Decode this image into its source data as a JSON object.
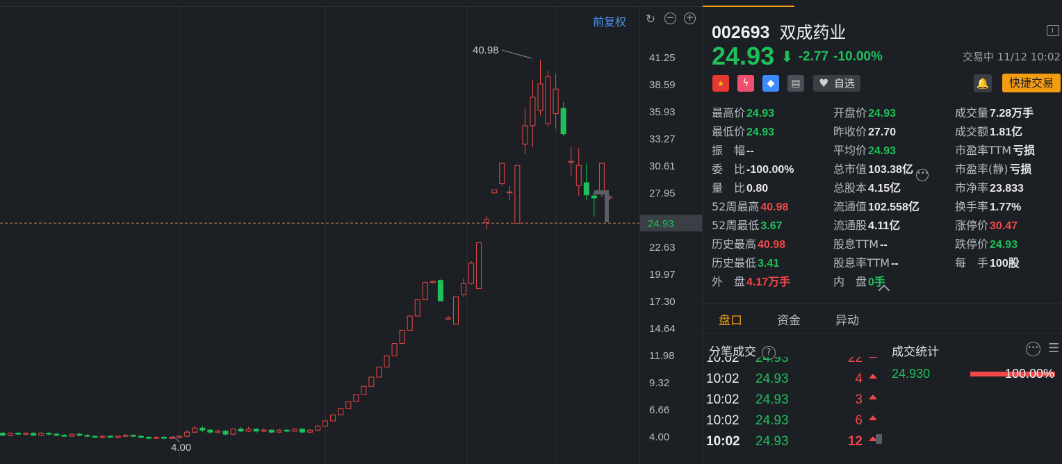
{
  "chart": {
    "adjust_mode": "前复权",
    "high_label": "40.98",
    "low_label": "4.00",
    "y_ticks": [
      "41.25",
      "38.59",
      "35.93",
      "33.27",
      "30.61",
      "27.95",
      "24.93",
      "22.63",
      "19.97",
      "17.30",
      "14.64",
      "11.98",
      "9.32",
      "6.66",
      "4.00"
    ],
    "current_price_tag": "24.93",
    "colors": {
      "up": "#f04848",
      "down": "#1fc05a",
      "price_tag": "#3a3e45",
      "dash": "#c88a4a"
    }
  },
  "chart_data": {
    "type": "candlestick",
    "ylim": [
      4.0,
      41.25
    ],
    "current_price": 24.93,
    "candles": [
      {
        "o": 4.3,
        "c": 4.1,
        "h": 4.4,
        "l": 4.0
      },
      {
        "o": 4.1,
        "c": 4.3,
        "h": 4.4,
        "l": 4.0
      },
      {
        "o": 4.3,
        "c": 4.2,
        "h": 4.4,
        "l": 4.1
      },
      {
        "o": 4.2,
        "c": 4.3,
        "h": 4.4,
        "l": 4.1
      },
      {
        "o": 4.3,
        "c": 4.1,
        "h": 4.4,
        "l": 4.0
      },
      {
        "o": 4.1,
        "c": 4.3,
        "h": 4.4,
        "l": 4.0
      },
      {
        "o": 4.3,
        "c": 4.2,
        "h": 4.4,
        "l": 4.1
      },
      {
        "o": 4.2,
        "c": 4.1,
        "h": 4.3,
        "l": 4.0
      },
      {
        "o": 4.1,
        "c": 4.0,
        "h": 4.2,
        "l": 3.9
      },
      {
        "o": 4.0,
        "c": 4.2,
        "h": 4.3,
        "l": 3.9
      },
      {
        "o": 4.2,
        "c": 4.1,
        "h": 4.3,
        "l": 4.0
      },
      {
        "o": 4.1,
        "c": 4.0,
        "h": 4.2,
        "l": 3.9
      },
      {
        "o": 4.0,
        "c": 3.9,
        "h": 4.1,
        "l": 3.8
      },
      {
        "o": 3.9,
        "c": 4.0,
        "h": 4.1,
        "l": 3.8
      },
      {
        "o": 4.0,
        "c": 3.9,
        "h": 4.1,
        "l": 3.8
      },
      {
        "o": 3.9,
        "c": 4.0,
        "h": 4.1,
        "l": 3.8
      },
      {
        "o": 4.0,
        "c": 4.1,
        "h": 4.2,
        "l": 3.9
      },
      {
        "o": 4.1,
        "c": 4.0,
        "h": 4.2,
        "l": 3.9
      },
      {
        "o": 4.0,
        "c": 3.9,
        "h": 4.1,
        "l": 3.8
      },
      {
        "o": 3.9,
        "c": 3.8,
        "h": 4.0,
        "l": 3.7
      },
      {
        "o": 3.8,
        "c": 3.9,
        "h": 4.0,
        "l": 3.7
      },
      {
        "o": 3.9,
        "c": 3.8,
        "h": 4.0,
        "l": 3.7
      },
      {
        "o": 3.8,
        "c": 3.9,
        "h": 4.0,
        "l": 3.7
      },
      {
        "o": 3.9,
        "c": 4.0,
        "h": 4.1,
        "l": 3.8
      },
      {
        "o": 4.0,
        "c": 4.4,
        "h": 4.6,
        "l": 3.9
      },
      {
        "o": 4.4,
        "c": 4.8,
        "h": 5.0,
        "l": 4.3
      },
      {
        "o": 4.8,
        "c": 4.6,
        "h": 5.0,
        "l": 4.4
      },
      {
        "o": 4.6,
        "c": 4.4,
        "h": 4.7,
        "l": 4.2
      },
      {
        "o": 4.4,
        "c": 4.5,
        "h": 4.7,
        "l": 4.2
      },
      {
        "o": 4.5,
        "c": 4.2,
        "h": 4.6,
        "l": 4.1
      },
      {
        "o": 4.2,
        "c": 4.7,
        "h": 4.8,
        "l": 4.1
      },
      {
        "o": 4.7,
        "c": 4.5,
        "h": 4.9,
        "l": 4.4
      },
      {
        "o": 4.5,
        "c": 4.7,
        "h": 4.9,
        "l": 4.4
      },
      {
        "o": 4.7,
        "c": 4.5,
        "h": 4.8,
        "l": 4.3
      },
      {
        "o": 4.5,
        "c": 4.6,
        "h": 4.8,
        "l": 4.4
      },
      {
        "o": 4.6,
        "c": 4.4,
        "h": 4.7,
        "l": 4.3
      },
      {
        "o": 4.4,
        "c": 4.6,
        "h": 4.7,
        "l": 4.3
      },
      {
        "o": 4.6,
        "c": 4.5,
        "h": 4.7,
        "l": 4.4
      },
      {
        "o": 4.5,
        "c": 4.7,
        "h": 4.8,
        "l": 4.4
      },
      {
        "o": 4.7,
        "c": 4.4,
        "h": 4.8,
        "l": 4.3
      },
      {
        "o": 4.4,
        "c": 4.6,
        "h": 4.7,
        "l": 4.3
      },
      {
        "o": 4.6,
        "c": 5.0,
        "h": 5.1,
        "l": 4.5
      },
      {
        "o": 5.0,
        "c": 5.5,
        "h": 5.5,
        "l": 5.0
      },
      {
        "o": 5.5,
        "c": 6.1,
        "h": 6.1,
        "l": 5.5
      },
      {
        "o": 6.1,
        "c": 6.7,
        "h": 6.7,
        "l": 6.1
      },
      {
        "o": 6.7,
        "c": 7.4,
        "h": 7.4,
        "l": 6.7
      },
      {
        "o": 7.4,
        "c": 8.1,
        "h": 8.1,
        "l": 7.4
      },
      {
        "o": 8.1,
        "c": 8.9,
        "h": 8.9,
        "l": 8.1
      },
      {
        "o": 8.9,
        "c": 9.8,
        "h": 9.8,
        "l": 8.9
      },
      {
        "o": 9.8,
        "c": 10.8,
        "h": 10.8,
        "l": 9.8
      },
      {
        "o": 10.8,
        "c": 11.9,
        "h": 11.9,
        "l": 10.8
      },
      {
        "o": 11.9,
        "c": 13.1,
        "h": 13.1,
        "l": 11.9
      },
      {
        "o": 13.1,
        "c": 14.4,
        "h": 14.4,
        "l": 13.1
      },
      {
        "o": 14.4,
        "c": 15.8,
        "h": 15.8,
        "l": 14.4
      },
      {
        "o": 15.8,
        "c": 17.4,
        "h": 17.4,
        "l": 15.8
      },
      {
        "o": 17.4,
        "c": 19.1,
        "h": 19.1,
        "l": 17.4
      },
      {
        "o": 19.1,
        "c": 19.2,
        "h": 19.3,
        "l": 19.0
      },
      {
        "o": 19.3,
        "c": 17.3,
        "h": 19.4,
        "l": 17.3
      },
      {
        "o": 15.6,
        "c": 15.6,
        "h": 15.8,
        "l": 15.5
      },
      {
        "o": 15.0,
        "c": 17.7,
        "h": 17.7,
        "l": 15.0
      },
      {
        "o": 17.9,
        "c": 19.0,
        "h": 19.5,
        "l": 17.7
      },
      {
        "o": 19.0,
        "c": 21.0,
        "h": 21.2,
        "l": 18.9
      },
      {
        "o": 18.5,
        "c": 23.0,
        "h": 23.0,
        "l": 18.5
      },
      {
        "o": 25.0,
        "c": 25.3,
        "h": 25.6,
        "l": 24.3
      },
      {
        "o": 27.9,
        "c": 28.2,
        "h": 28.2,
        "l": 27.8
      },
      {
        "o": 28.8,
        "c": 30.8,
        "h": 30.8,
        "l": 28.6
      },
      {
        "o": 28.0,
        "c": 28.0,
        "h": 28.6,
        "l": 27.2
      },
      {
        "o": 24.9,
        "c": 30.6,
        "h": 30.6,
        "l": 24.9
      },
      {
        "o": 32.7,
        "c": 34.5,
        "h": 36.2,
        "l": 31.7
      },
      {
        "o": 34.5,
        "c": 37.3,
        "h": 39.0,
        "l": 32.4
      },
      {
        "o": 36.0,
        "c": 38.6,
        "h": 41.0,
        "l": 35.5
      },
      {
        "o": 34.7,
        "c": 39.3,
        "h": 39.9,
        "l": 34.4
      },
      {
        "o": 35.7,
        "c": 38.1,
        "h": 39.6,
        "l": 34.2
      },
      {
        "o": 36.2,
        "c": 33.7,
        "h": 36.8,
        "l": 33.5
      },
      {
        "o": 31.0,
        "c": 31.0,
        "h": 32.4,
        "l": 29.6
      },
      {
        "o": 28.6,
        "c": 30.6,
        "h": 32.3,
        "l": 27.6
      },
      {
        "o": 28.9,
        "c": 27.7,
        "h": 30.8,
        "l": 27.2
      },
      {
        "o": 27.6,
        "c": 27.4,
        "h": 28.0,
        "l": 25.6
      },
      {
        "o": 28.1,
        "c": 30.8,
        "h": 30.8,
        "l": 27.5
      },
      {
        "o": 27.5,
        "c": 27.5,
        "h": 27.7,
        "l": 27.2
      }
    ]
  },
  "toolbar": {
    "reset_icon": "↻",
    "zoom_out": "−",
    "zoom_in": "+"
  },
  "quote": {
    "code": "002693",
    "name": "双成药业",
    "price": "24.93",
    "change": "-2.77",
    "change_pct": "-10.00%",
    "status": "交易中 11/12 10:02",
    "badges": [
      "cn-flag-icon",
      "margin-icon",
      "tag-icon",
      "note-icon"
    ],
    "favorite_label": "自选",
    "quick_trade_label": "快捷交易",
    "stats_col1": [
      {
        "label": "最高价",
        "value": "24.93",
        "tone": "green"
      },
      {
        "label": "最低价",
        "value": "24.93",
        "tone": "green"
      },
      {
        "label": "振　幅",
        "value": "--",
        "tone": "white"
      },
      {
        "label": "委　比",
        "value": "-100.00%",
        "tone": "white"
      },
      {
        "label": "量　比",
        "value": "0.80",
        "tone": "white"
      },
      {
        "label": "52周最高",
        "value": "40.98",
        "tone": "red"
      },
      {
        "label": "52周最低",
        "value": "3.67",
        "tone": "green"
      },
      {
        "label": "历史最高",
        "value": "40.98",
        "tone": "red"
      },
      {
        "label": "历史最低",
        "value": "3.41",
        "tone": "green"
      },
      {
        "label": "外　盘",
        "value": "4.17万手",
        "tone": "red"
      }
    ],
    "stats_col2": [
      {
        "label": "开盘价",
        "value": "24.93",
        "tone": "green"
      },
      {
        "label": "昨收价",
        "value": "27.70",
        "tone": "white"
      },
      {
        "label": "平均价",
        "value": "24.93",
        "tone": "green"
      },
      {
        "label": "总市值",
        "value": "103.38亿",
        "tone": "white"
      },
      {
        "label": "总股本",
        "value": "4.15亿",
        "tone": "white"
      },
      {
        "label": "流通值",
        "value": "102.558亿",
        "tone": "white"
      },
      {
        "label": "流通股",
        "value": "4.11亿",
        "tone": "white"
      },
      {
        "label": "股息TTM",
        "value": "--",
        "tone": "white"
      },
      {
        "label": "股息率TTM",
        "value": "--",
        "tone": "white"
      },
      {
        "label": "内　盘",
        "value": "0手",
        "tone": "green"
      }
    ],
    "stats_col3": [
      {
        "label": "成交量",
        "value": "7.28万手",
        "tone": "white"
      },
      {
        "label": "成交额",
        "value": "1.81亿",
        "tone": "white"
      },
      {
        "label": "市盈率TTM",
        "value": "亏损",
        "tone": "white"
      },
      {
        "label": "市盈率(静)",
        "value": "亏损",
        "tone": "white"
      },
      {
        "label": "市净率",
        "value": "23.833",
        "tone": "white"
      },
      {
        "label": "换手率",
        "value": "1.77%",
        "tone": "white"
      },
      {
        "label": "涨停价",
        "value": "30.47",
        "tone": "red"
      },
      {
        "label": "跌停价",
        "value": "24.93",
        "tone": "green"
      },
      {
        "label": "每　手",
        "value": "100股",
        "tone": "white"
      }
    ]
  },
  "tabs": [
    "盘口",
    "资金",
    "异动"
  ],
  "ticks_section": {
    "title": "分笔成交",
    "rows": [
      {
        "time": "10:02",
        "price": "24.93",
        "vol": "22"
      },
      {
        "time": "10:02",
        "price": "24.93",
        "vol": "4"
      },
      {
        "time": "10:02",
        "price": "24.93",
        "vol": "3"
      },
      {
        "time": "10:02",
        "price": "24.93",
        "vol": "6"
      },
      {
        "time": "10:02",
        "price": "24.93",
        "vol": "12"
      }
    ]
  },
  "deal_stats": {
    "title": "成交统计",
    "price": "24.930",
    "pct": "100.00%",
    "fraction": 1.0
  }
}
